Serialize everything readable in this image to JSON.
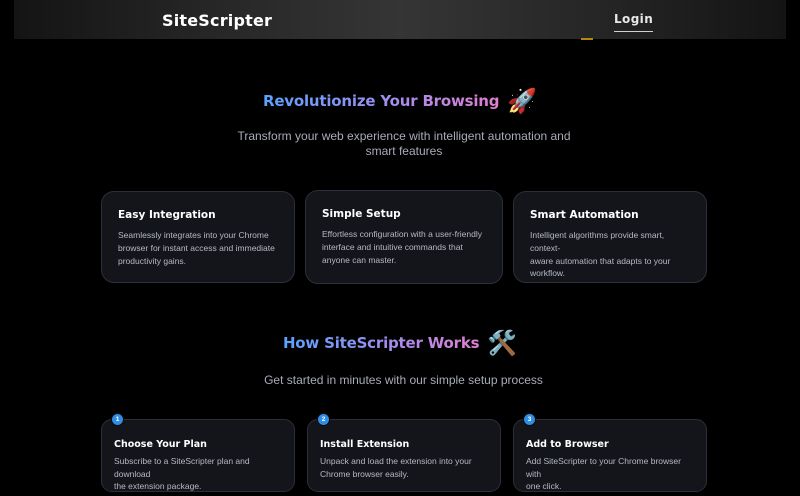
{
  "header": {
    "brand": "SiteScripter",
    "login_label": "Login"
  },
  "hero": {
    "title": "Revolutionize Your Browsing",
    "emoji": "🚀",
    "subtitle_line1": "Transform your web experience with intelligent automation and",
    "subtitle_line2": "smart features"
  },
  "features": [
    {
      "title": "Easy Integration",
      "lines": [
        "Seamlessly integrates into your Chrome",
        "browser for instant access and immediate",
        "productivity gains."
      ]
    },
    {
      "title": "Simple Setup",
      "lines": [
        "Effortless configuration with a user-friendly",
        "interface and intuitive commands that",
        "anyone can master."
      ]
    },
    {
      "title": "Smart Automation",
      "lines": [
        "Intelligent algorithms provide smart, context-",
        "aware automation that adapts to your",
        "workflow."
      ]
    }
  ],
  "how": {
    "title": "How SiteScripter Works",
    "emoji": "🛠️",
    "subtitle": "Get started in minutes with our simple setup process"
  },
  "steps": [
    {
      "number": "1",
      "title": "Choose Your Plan",
      "lines": [
        "Subscribe to a SiteScripter plan and download",
        "the extension package."
      ]
    },
    {
      "number": "2",
      "title": "Install Extension",
      "lines": [
        "Unpack and load the extension into your",
        "Chrome browser easily."
      ]
    },
    {
      "number": "3",
      "title": "Add to Browser",
      "lines": [
        "Add SiteScripter to your Chrome browser with",
        "one click."
      ]
    }
  ],
  "colors": {
    "background": "#000000",
    "card_bg": "#13151b",
    "card_border": "#2c2f38",
    "heading_gradient_start": "#5aa3ff",
    "heading_gradient_end": "#e27fd2",
    "step_badge": "#2f8de4"
  }
}
